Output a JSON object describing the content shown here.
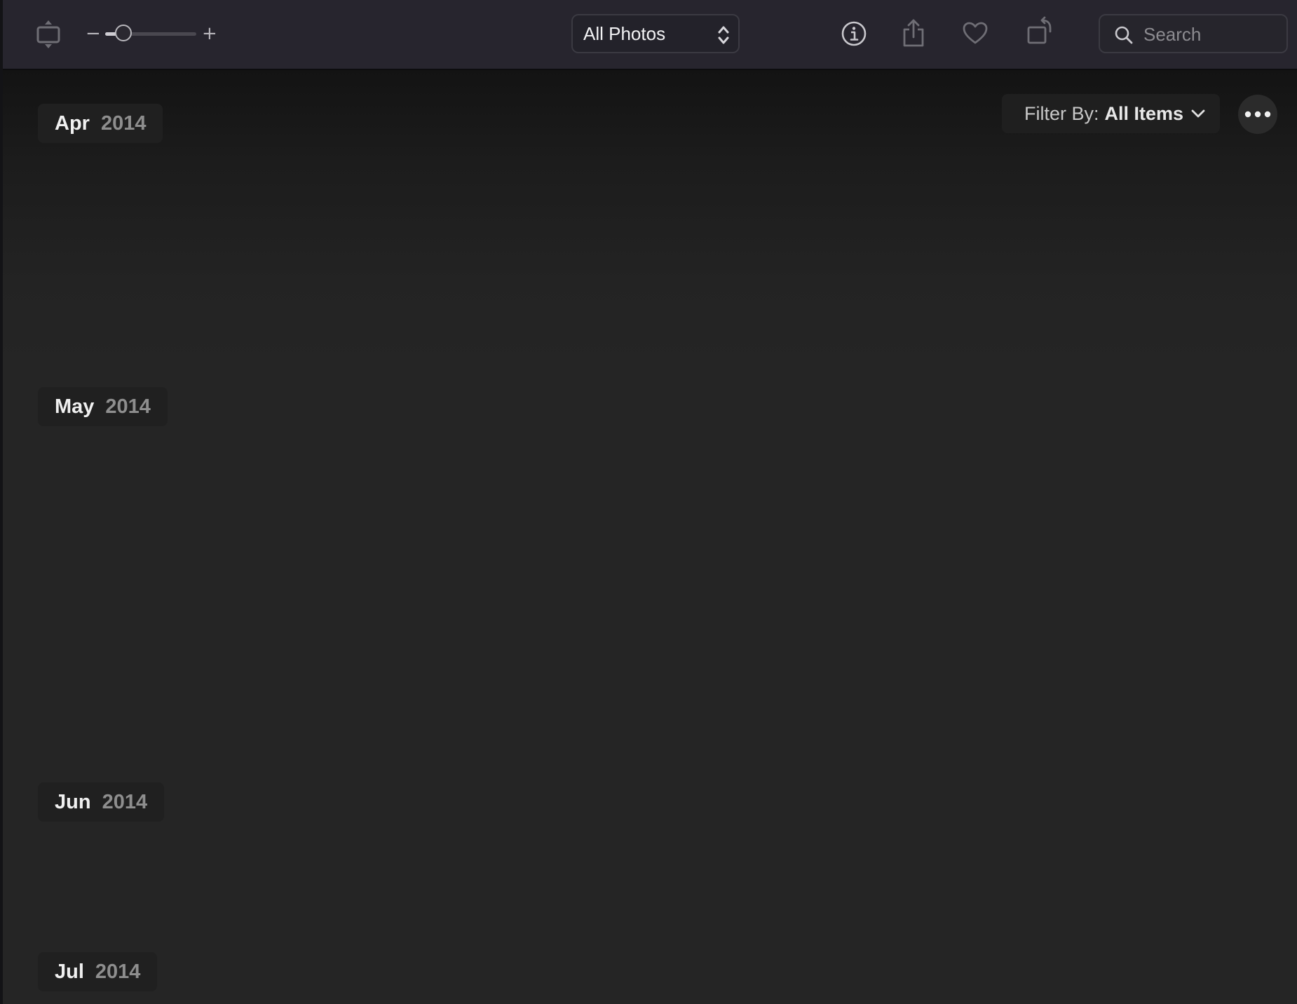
{
  "toolbar": {
    "slider": {
      "minus_label": "−",
      "plus_label": "+",
      "value": 0.2
    },
    "view_select": {
      "selected": "All Photos"
    },
    "icons": {
      "slideshow": "slideshow-icon",
      "info": "info-icon",
      "share": "share-icon",
      "favorite": "heart-icon",
      "rotate": "rotate-icon",
      "search": "search-icon"
    },
    "search": {
      "placeholder": "Search"
    }
  },
  "filter": {
    "prefix": "Filter By:",
    "value": "All Items"
  },
  "more_button": {
    "icon": "ellipsis-icon"
  },
  "months": [
    {
      "month": "Apr",
      "year": "2014"
    },
    {
      "month": "May",
      "year": "2014"
    },
    {
      "month": "Jun",
      "year": "2014"
    },
    {
      "month": "Jul",
      "year": "2014"
    }
  ],
  "colors": {
    "toolbar_bg": "#27252e",
    "content_bg": "#252525",
    "icon_gray": "#8d8c93"
  }
}
